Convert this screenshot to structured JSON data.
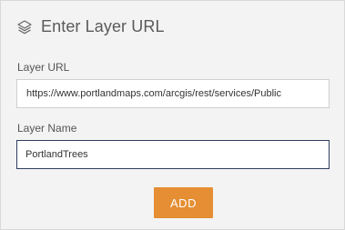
{
  "dialog": {
    "title": "Enter Layer URL",
    "icon": "layers-icon"
  },
  "form": {
    "layer_url": {
      "label": "Layer URL",
      "value": "https://www.portlandmaps.com/arcgis/rest/services/Public"
    },
    "layer_name": {
      "label": "Layer Name",
      "value": "PortlandTrees"
    }
  },
  "actions": {
    "add_label": "ADD"
  },
  "colors": {
    "accent": "#e58e33",
    "focus_border": "#2f3f5f"
  }
}
